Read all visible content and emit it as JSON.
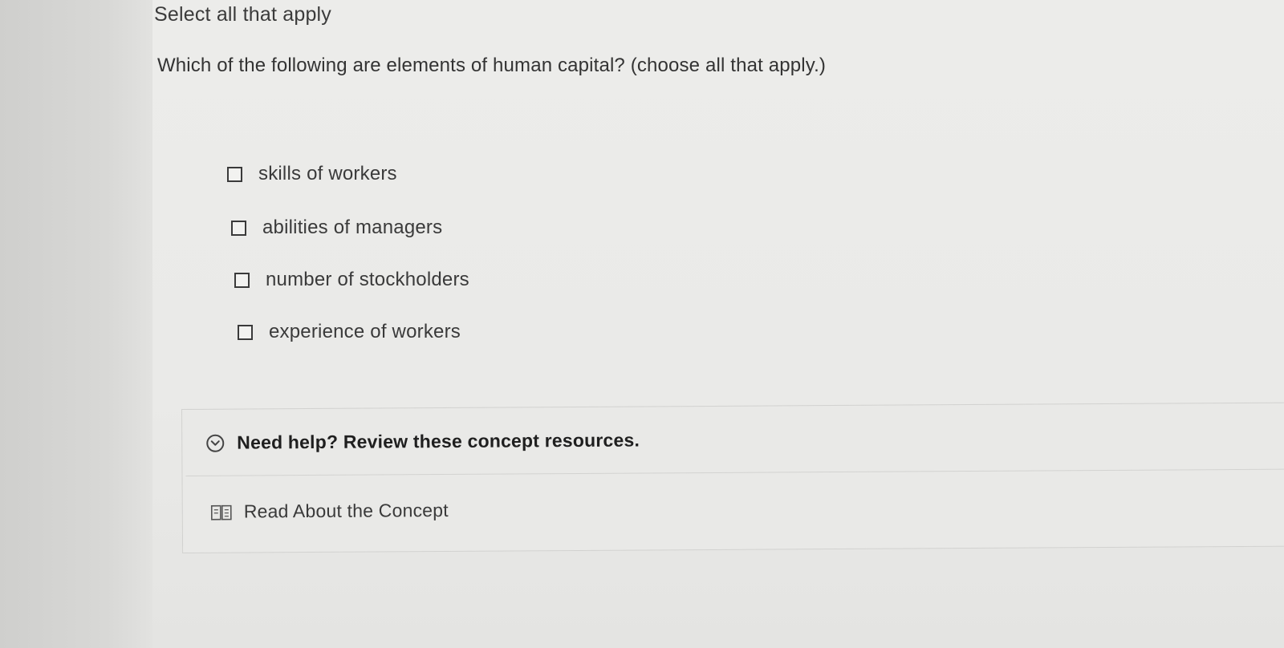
{
  "header": {
    "instruction": "Select all that apply"
  },
  "question": {
    "text": "Which of the following are elements of human capital? (choose all that apply.)",
    "options": [
      {
        "label": "skills of workers",
        "checked": false
      },
      {
        "label": "abilities of managers",
        "checked": false
      },
      {
        "label": "number of stockholders",
        "checked": false
      },
      {
        "label": "experience of workers",
        "checked": false
      }
    ]
  },
  "help": {
    "title": "Need help? Review these concept resources.",
    "expand_icon": "chevron-down-circle-icon",
    "resources": [
      {
        "label": "Read About the Concept",
        "icon": "book-icon"
      }
    ]
  }
}
